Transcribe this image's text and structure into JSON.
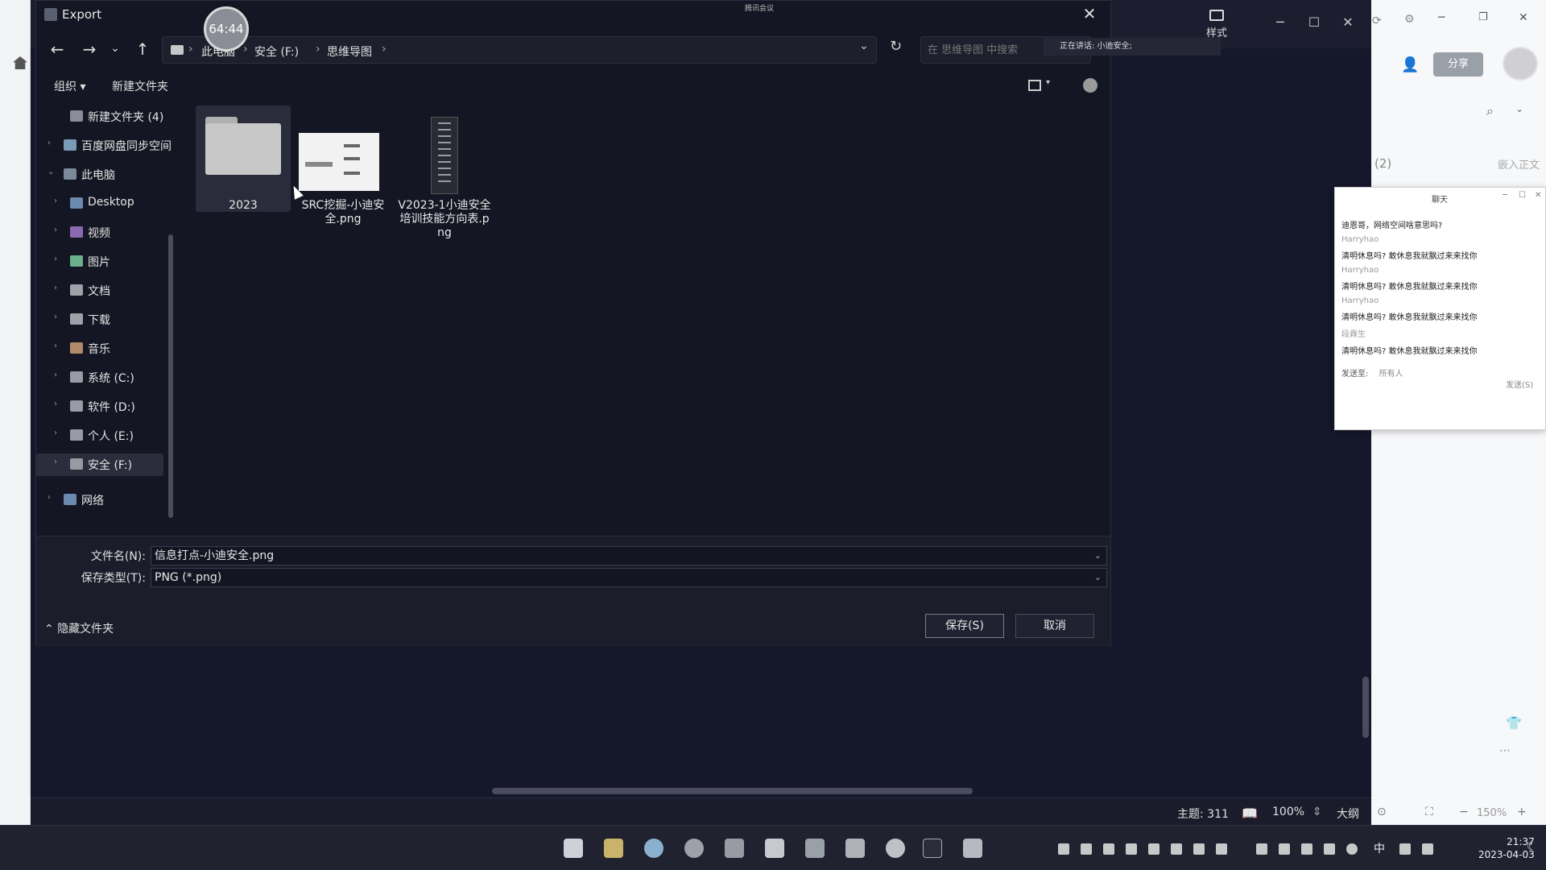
{
  "timer": "64:44",
  "background_app": {
    "style_label": "样式",
    "share_label": "分享",
    "status_topics": "主题: 311",
    "zoom": "100%",
    "outline_label": "大纲",
    "right_zoom": "150%",
    "insert_label": "嵌入正文",
    "count_label": "(2)"
  },
  "chat": {
    "title": "聊天",
    "first_msg": "迪恩哥，网络空间啥意思吗?",
    "messages": [
      {
        "name": "Harryhao",
        "text": "清明休息吗? 敢休息我就飘过来来找你"
      },
      {
        "name": "Harryhao",
        "text": "清明休息吗? 敢休息我就飘过来来找你"
      },
      {
        "name": "Harryhao",
        "text": "清明休息吗? 敢休息我就飘过来来找你"
      },
      {
        "name": "段霖生",
        "text": "清明休息吗? 敢休息我就飘过来来找你"
      }
    ],
    "send_to_label": "发送至:",
    "send_to_value": "所有人",
    "send_btn": "发送(S)"
  },
  "meeting_bar": "腾讯会议",
  "speaking": "正在讲话: 小迪安全;",
  "dialog": {
    "title": "Export",
    "breadcrumbs": [
      "此电脑",
      "安全 (F:)",
      "思维导图"
    ],
    "search_placeholder": "在 思维导图 中搜索",
    "toolbar": {
      "organize": "组织 ▾",
      "new_folder": "新建文件夹"
    },
    "nav_items": [
      {
        "label": "新建文件夹 (4)",
        "icon_color": "#8a8d96"
      },
      {
        "label": "百度网盘同步空间",
        "icon_color": "#7a9ab8"
      },
      {
        "label": "此电脑",
        "icon_color": "#7a8a9a"
      },
      {
        "label": "Desktop",
        "icon_color": "#6a8ab0"
      },
      {
        "label": "视频",
        "icon_color": "#8a6ab0"
      },
      {
        "label": "图片",
        "icon_color": "#6ab08a"
      },
      {
        "label": "文档",
        "icon_color": "#a0a0a8"
      },
      {
        "label": "下载",
        "icon_color": "#a0a0a8"
      },
      {
        "label": "音乐",
        "icon_color": "#b08a6a"
      },
      {
        "label": "系统 (C:)",
        "icon_color": "#9a9aa4"
      },
      {
        "label": "软件 (D:)",
        "icon_color": "#9a9aa4"
      },
      {
        "label": "个人 (E:)",
        "icon_color": "#9a9aa4"
      },
      {
        "label": "安全 (F:)",
        "icon_color": "#9a9aa4"
      },
      {
        "label": "网络",
        "icon_color": "#6a8ab0"
      }
    ],
    "files": [
      {
        "name": "2023",
        "type": "folder"
      },
      {
        "name": "SRC挖掘-小迪安全.png",
        "type": "image"
      },
      {
        "name": "V2023-1小迪安全培训技能方向表.png",
        "type": "image"
      }
    ],
    "filename_label": "文件名(N):",
    "filename_value": "信息打点-小迪安全.png",
    "filetype_label": "保存类型(T):",
    "filetype_value": "PNG (*.png)",
    "hide_folders": "隐藏文件夹",
    "save_btn": "保存(S)",
    "cancel_btn": "取消"
  },
  "taskbar": {
    "ime": "中",
    "time": "21:37",
    "date": "2023-04-03"
  }
}
